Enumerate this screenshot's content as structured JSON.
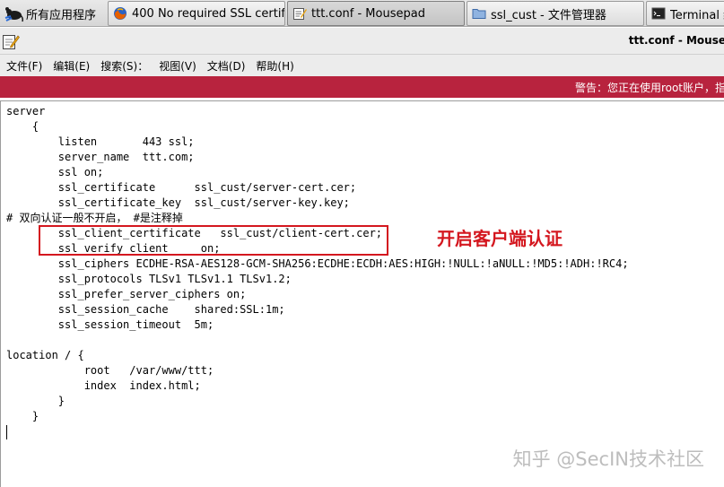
{
  "taskbar": {
    "apps_menu_label": "所有应用程序",
    "tasks": [
      {
        "label": "400 No required SSL certifi…",
        "icon": "firefox-icon"
      },
      {
        "label": "ttt.conf - Mousepad",
        "icon": "text-editor-icon"
      },
      {
        "label": "ssl_cust - 文件管理器",
        "icon": "folder-icon"
      },
      {
        "label": "Terminal 终",
        "icon": "terminal-icon"
      }
    ]
  },
  "window": {
    "title": "ttt.conf - Mouse"
  },
  "menu": {
    "items": [
      "文件(F)",
      "编辑(E)",
      "搜索(S)：",
      "视图(V)",
      "文档(D)",
      "帮助(H)"
    ]
  },
  "warning": {
    "text": "警告：您正在使用root账户，指"
  },
  "editor": {
    "lines": [
      "server",
      "    {",
      "        listen       443 ssl;",
      "        server_name  ttt.com;",
      "        ssl on;",
      "        ssl_certificate      ssl_cust/server-cert.cer;",
      "        ssl_certificate_key  ssl_cust/server-key.key;",
      "# 双向认证一般不开启， #是注释掉",
      "        ssl_client_certificate   ssl_cust/client-cert.cer;",
      "        ssl_verify_client     on;",
      "        ssl_ciphers ECDHE-RSA-AES128-GCM-SHA256:ECDHE:ECDH:AES:HIGH:!NULL:!aNULL:!MD5:!ADH:!RC4;",
      "        ssl_protocols TLSv1 TLSv1.1 TLSv1.2;",
      "        ssl_prefer_server_ciphers on;",
      "        ssl_session_cache    shared:SSL:1m;",
      "        ssl_session_timeout  5m;",
      "",
      "location / {",
      "            root   /var/www/ttt;",
      "            index  index.html;",
      "        }",
      "    }"
    ]
  },
  "annotation": {
    "text": "开启客户端认证",
    "color": "#d4171f"
  },
  "watermark": "知乎 @SecIN技术社区",
  "colors": {
    "warning_bg": "#b8233e"
  }
}
